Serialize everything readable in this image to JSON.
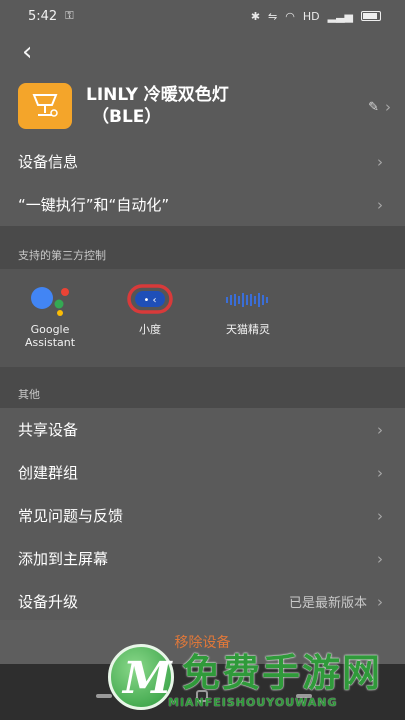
{
  "status_bar": {
    "time": "5:42",
    "network": "HD"
  },
  "device": {
    "name_line1": "LINLY 冷暖双色灯",
    "name_line2": "（BLE）"
  },
  "rows_top": [
    {
      "label": "设备信息"
    },
    {
      "label": "“一键执行”和“自动化”"
    }
  ],
  "third_party": {
    "title": "支持的第三方控制",
    "items": [
      {
        "label": "Google Assistant",
        "icon": "google-assistant-icon"
      },
      {
        "label": "小度",
        "icon": "xiaodu-icon"
      },
      {
        "label": "天猫精灵",
        "icon": "tmall-genie-icon"
      }
    ]
  },
  "other": {
    "title": "其他",
    "rows": [
      {
        "label": "共享设备"
      },
      {
        "label": "创建群组"
      },
      {
        "label": "常见问题与反馈"
      },
      {
        "label": "添加到主屏幕"
      },
      {
        "label": "设备升级",
        "value": "已是最新版本"
      }
    ]
  },
  "remove_label": "移除设备",
  "watermark": {
    "title": "免费手游网",
    "subtitle": "MIANFEISHOUYOUWANG",
    "logo_letter": "M"
  },
  "colors": {
    "background": "#5a5a5a",
    "device_icon": "#f4a52a",
    "remove": "#e0783a",
    "watermark": "#2f9a3a"
  }
}
